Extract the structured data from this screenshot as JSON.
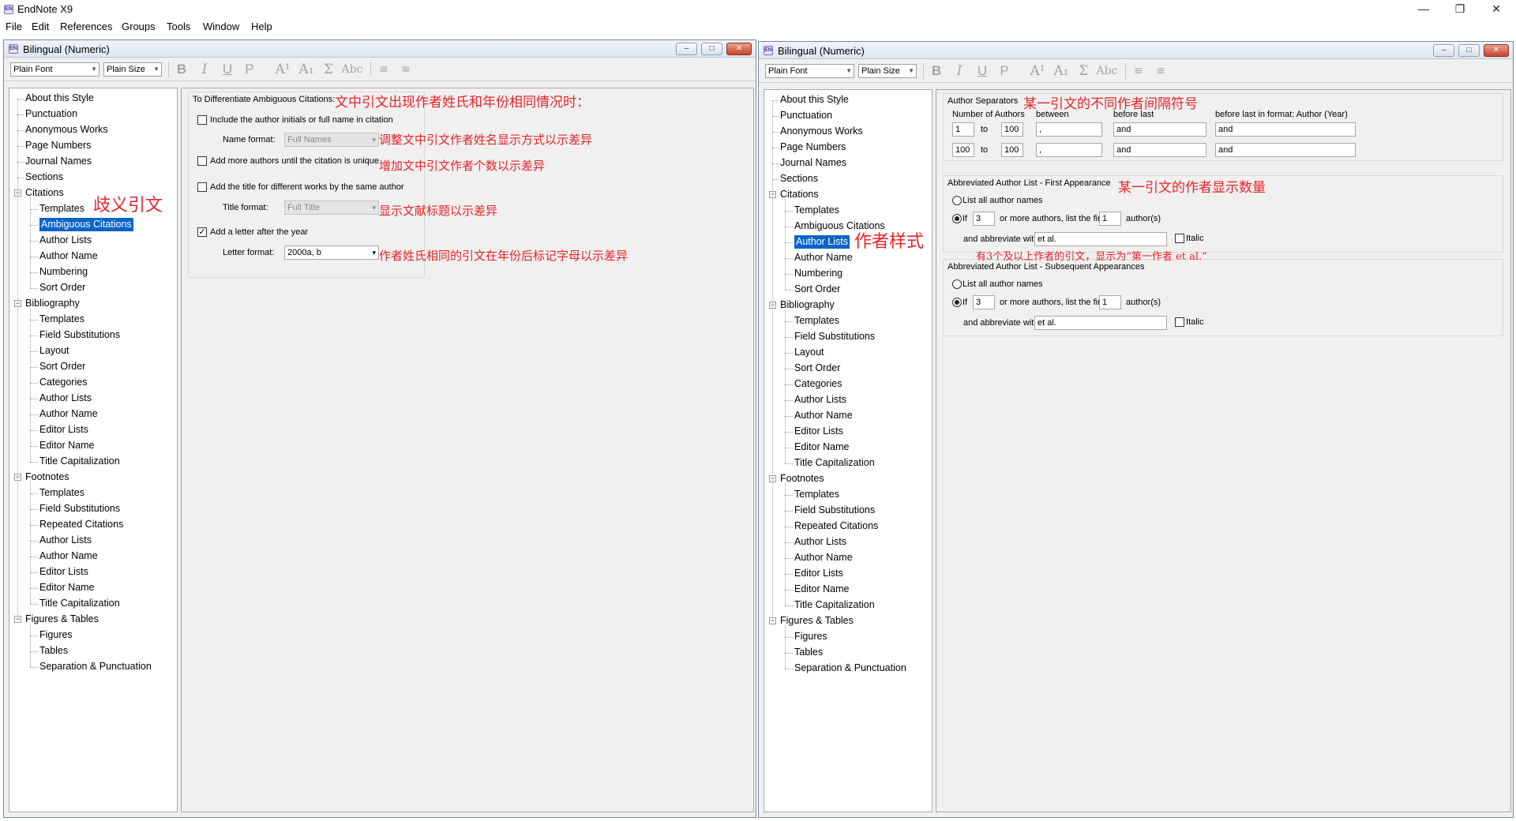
{
  "app": {
    "title": "EndNote X9",
    "icon_label": "EN",
    "menu": [
      "File",
      "Edit",
      "References",
      "Groups",
      "Tools",
      "Window",
      "Help"
    ],
    "controls": {
      "minimize": "—",
      "restore": "❐",
      "close": "✕"
    }
  },
  "windows": [
    {
      "title": "Bilingual (Numeric)",
      "font_select": "Plain Font",
      "size_select": "Plain Size",
      "toolbar": [
        "B",
        "I",
        "U",
        "P",
        "A¹",
        "A₁",
        "Σ",
        "Abc"
      ]
    },
    {
      "title": "Bilingual (Numeric)",
      "font_select": "Plain Font",
      "size_select": "Plain Size",
      "toolbar": [
        "B",
        "I",
        "U",
        "P",
        "A¹",
        "A₁",
        "Σ",
        "Abc"
      ]
    }
  ],
  "tree": [
    "About this Style",
    "Punctuation",
    "Anonymous Works",
    "Page Numbers",
    "Journal Names",
    "Sections",
    "Citations",
    "Templates",
    "Ambiguous Citations",
    "Author Lists",
    "Author Name",
    "Numbering",
    "Sort Order",
    "Bibliography",
    "Templates",
    "Field Substitutions",
    "Layout",
    "Sort Order",
    "Categories",
    "Author Lists",
    "Author Name",
    "Editor Lists",
    "Editor Name",
    "Title Capitalization",
    "Footnotes",
    "Templates",
    "Field Substitutions",
    "Repeated Citations",
    "Author Lists",
    "Author Name",
    "Editor Lists",
    "Editor Name",
    "Title Capitalization",
    "Figures & Tables",
    "Figures",
    "Tables",
    "Separation & Punctuation"
  ],
  "tree_left": [
    "About this Style",
    "Punctuation",
    "Anonymous Works",
    "Page Numbers",
    "Journal Names",
    "Sections",
    "Citations",
    "Templates",
    "Ambiguous Citations",
    "Author Lists",
    "Author Name",
    "Numbering",
    "Sort Order",
    "Bibliography",
    "Templates",
    "Field Substitutions",
    "Layout",
    "Sort Order",
    "Categories",
    "Author Lists",
    "Author Name",
    "Editor Lists",
    "Editor Name",
    "Title Capitalization",
    "Footnotes",
    "Templates",
    "Field Substitutions",
    "Repeated Citations",
    "Author Lists",
    "Author Name",
    "Editor Lists",
    "Editor Name",
    "Title Capitalization",
    "Figures & Tables",
    "Figures",
    "Tables",
    "Separation & Punctuation"
  ],
  "ambiguous": {
    "header": "To Differentiate Ambiguous Citations:",
    "opt1": "Include the author initials or full name in citation",
    "name_format_label": "Name format:",
    "name_format_value": "Full Names",
    "opt2": "Add more authors until the citation is unique",
    "opt3": "Add the title for different works by the same author",
    "title_format_label": "Title format:",
    "title_format_value": "Full Title",
    "opt4": "Add a letter after the year",
    "letter_format_label": "Letter format:",
    "letter_format_value": "2000a, b"
  },
  "author_lists": {
    "sep_header": "Author Separators",
    "col_num": "Number of Authors",
    "col_between": "between",
    "col_before_last": "before last",
    "col_before_last_fmt": "before last in format: Author (Year)",
    "to": "to",
    "row1": {
      "from": "1",
      "to": "100",
      "between": ",",
      "before_last": "and",
      "before_last_fmt": "and"
    },
    "row2": {
      "from": "100",
      "to": "100",
      "between": ",",
      "before_last": "and",
      "before_last_fmt": "and"
    },
    "first_header": "Abbreviated Author List - First Appearance",
    "list_all": "List all author names",
    "if_label": "If",
    "if_count": "3",
    "more_text": "or more authors, list the first",
    "first_count": "1",
    "authors_suffix": "author(s)",
    "abbrev_label": "and abbreviate with:",
    "abbrev_value": "et al.",
    "italic_label": "Italic",
    "subseq_header": "Abbreviated Author List - Subsequent Appearances",
    "list_all_2": "List all author names",
    "if_label_2": "If",
    "if_count_2": "3",
    "more_text_2": "or more authors, list the first",
    "first_count_2": "1",
    "authors_suffix_2": "author(s)",
    "abbrev_label_2": "and abbreviate with:",
    "abbrev_value_2": "et al.",
    "italic_label_2": "Italic"
  },
  "annotations": {
    "ambiguous_label": "歧义引文",
    "ambiguous_header": "文中引文出现作者姓氏和年份相同情况时：",
    "opt1_note": "调整文中引文作者姓名显示方式以示差异",
    "opt2_note": "增加文中引文作者个数以示差异",
    "opt3_note": "显示文献标题以示差异",
    "opt4_note": "作者姓氏相同的引文在年份后标记字母以示差异",
    "author_style": "作者样式",
    "separator_note": "某一引文的不同作者间隔符号",
    "count_note": "某一引文的作者显示数量",
    "etal_note": "有3个及以上作者的引文，显示为“第一作者 et al.”"
  },
  "colors": {
    "annotation": "#e8232a",
    "selection": "#0a64c8"
  }
}
